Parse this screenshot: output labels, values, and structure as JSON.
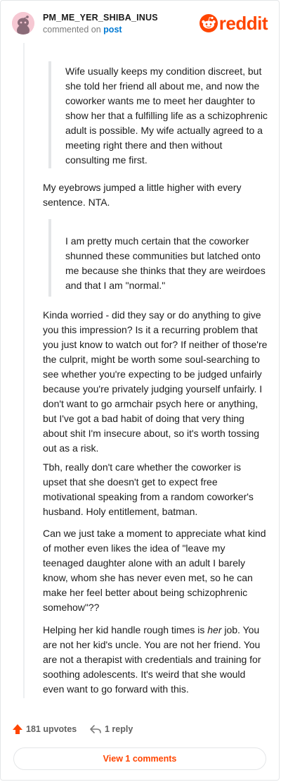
{
  "header": {
    "username": "PM_ME_YER_SHIBA_INUS",
    "meta_prefix": "commented on",
    "meta_link": "post",
    "logo_text": "reddit"
  },
  "blocks": {
    "quote1": "Wife usually keeps my condition discreet, but she told her friend all about me, and now the coworker wants me to meet her daughter to show her that a fulfilling life as a schizophrenic adult is possible. My wife actually agreed to a meeting right there and then without consulting me first.",
    "p1": "My eyebrows jumped a little higher with every sentence. NTA.",
    "quote2": "I am pretty much certain that the coworker shunned these communities but latched onto me because she thinks that they are weirdoes and that I am \"normal.\"",
    "p2": "Kinda worried - did they say or do anything to give you this impression? Is it a recurring problem that you just know to watch out for? If neither of those're the culprit, might be worth some soul-searching to see whether you're expecting to be judged unfairly because you're privately judging yourself unfairly. I don't want to go armchair psych here or anything, but I've got a bad habit of doing that very thing about shit I'm insecure about, so it's worth tossing out as a risk.",
    "p3": "Tbh, really don't care whether the coworker is upset that she doesn't get to expect free motivational speaking from a random coworker's husband. Holy entitlement, batman.",
    "p4": "Can we just take a moment to appreciate what kind of mother even likes the idea of \"leave my teenaged daughter alone with an adult I barely know, whom she has never even met, so he can make her feel better about being schizophrenic somehow\"??",
    "p5_before": "Helping her kid handle rough times is ",
    "p5_em": "her",
    "p5_after": " job. You are not her kid's uncle. You are not her friend. You are not a therapist with credentials and training for soothing adolescents. It's weird that she would even want to go forward with this."
  },
  "footer": {
    "upvotes": "181 upvotes",
    "replies": "1 reply",
    "view_button": "View 1 comments"
  },
  "colors": {
    "accent": "#ff4500",
    "link": "#0079d3",
    "muted": "#7c7c7c"
  }
}
